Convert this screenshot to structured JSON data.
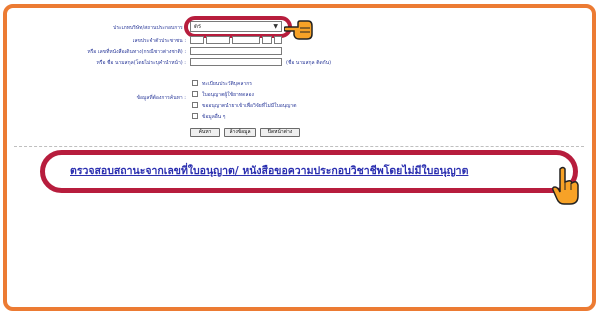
{
  "form": {
    "select_label": "ประเภทบริษัท/สถานประกอบการ :",
    "select_value": "ดร",
    "id_label": "เลขประจำตัวประชาชน :",
    "passport_label": "หรือ เลขที่หนังสือเดินทาง(กรณีชาวต่างชาติ) :",
    "name_label": "หรือ ชื่อ นามสกุล(โดยไม่ระบุคำนำหน้า) :",
    "name_hint": "(ชื่อ นามสกุล ติดกัน)",
    "options_label": "ข้อมูลที่ต้องการค้นหา :",
    "options": [
      "ทะเบียนประวัติบุคลากร",
      "ใบอนุญาตผู้ใช้ยาทดลอง",
      "ขออนุญาตนำยาเข้าเพื่อวิจัยที่ไม่มีใบอนุญาต",
      "ข้อมูลอื่น ๆ"
    ],
    "buttons": [
      "ค้นหา",
      "ล้างข้อมูล",
      "ปิดหน้าต่าง"
    ]
  },
  "main_link": "ตรวจสอบสถานะจากเลขที่ใบอนุญาต/ หนังสือขอความประกอบวิชาชีพโดยไม่มีใบอนุญาต",
  "colors": {
    "frame": "#ec7b33",
    "highlight_ring": "#b71d3d",
    "link": "#2b2fb0",
    "label": "#2b3a9a"
  },
  "icons": {
    "pointer_top": "pointing-hand-icon",
    "pointer_bottom": "click-hand-icon"
  }
}
